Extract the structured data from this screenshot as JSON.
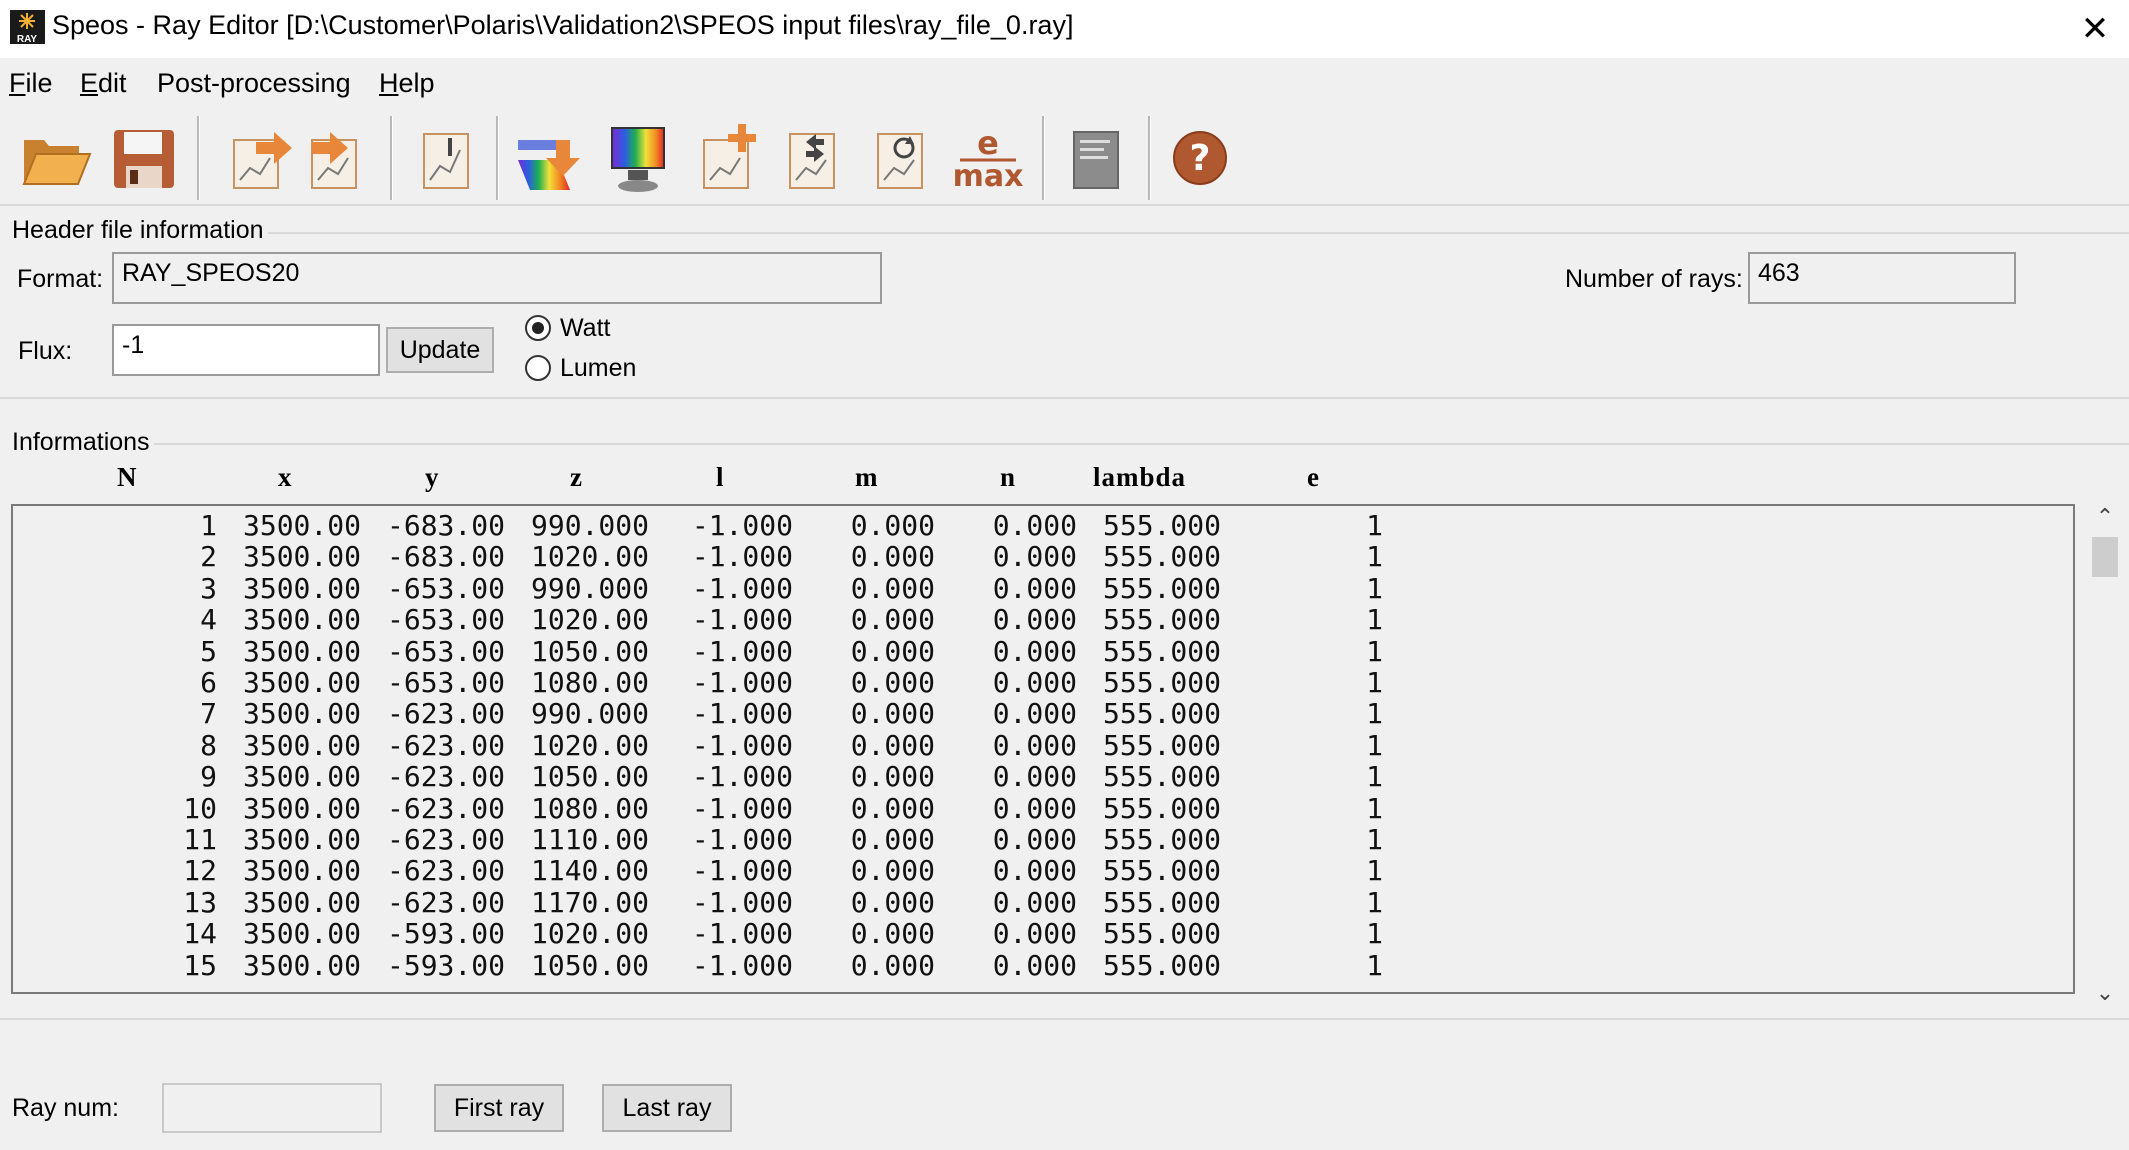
{
  "window": {
    "icon_label": "RAY",
    "title": "Speos - Ray Editor [D:\\Customer\\Polaris\\Validation2\\SPEOS input files\\ray_file_0.ray]",
    "close_glyph": "✕"
  },
  "menu": [
    {
      "accel": "F",
      "rest": "ile"
    },
    {
      "accel": "E",
      "rest": "dit"
    },
    {
      "accel": "",
      "rest": "Post-processing"
    },
    {
      "accel": "H",
      "rest": "elp"
    }
  ],
  "toolbar": {
    "icons": [
      "open-folder-icon",
      "save-disk-icon",
      "export-chart-icon",
      "import-chart-icon",
      "chart-settings-icon",
      "spectrum-download-icon",
      "spectrum-monitor-icon",
      "add-chart-icon",
      "chart-swap-icon",
      "chart-refresh-icon",
      "e-max-icon",
      "notepad-icon",
      "help-icon"
    ],
    "emax_top": "e",
    "emax_bottom": "max",
    "help_glyph": "?"
  },
  "header": {
    "group_label": "Header file information",
    "format_label": "Format:",
    "format_value": "RAY_SPEOS20",
    "rays_label": "Number of rays:",
    "rays_value": "463",
    "flux_label": "Flux:",
    "flux_value": "-1",
    "update_label": "Update",
    "unit_options": [
      "Watt",
      "Lumen"
    ],
    "unit_selected": "Watt"
  },
  "informations": {
    "group_label": "Informations",
    "columns": [
      "N",
      "x",
      "y",
      "z",
      "l",
      "m",
      "n",
      "lambda",
      "e"
    ],
    "rows": [
      [
        "1",
        "3500.00",
        "-683.00",
        "990.000",
        "-1.000",
        "0.000",
        "0.000",
        "555.000",
        "1"
      ],
      [
        "2",
        "3500.00",
        "-683.00",
        "1020.00",
        "-1.000",
        "0.000",
        "0.000",
        "555.000",
        "1"
      ],
      [
        "3",
        "3500.00",
        "-653.00",
        "990.000",
        "-1.000",
        "0.000",
        "0.000",
        "555.000",
        "1"
      ],
      [
        "4",
        "3500.00",
        "-653.00",
        "1020.00",
        "-1.000",
        "0.000",
        "0.000",
        "555.000",
        "1"
      ],
      [
        "5",
        "3500.00",
        "-653.00",
        "1050.00",
        "-1.000",
        "0.000",
        "0.000",
        "555.000",
        "1"
      ],
      [
        "6",
        "3500.00",
        "-653.00",
        "1080.00",
        "-1.000",
        "0.000",
        "0.000",
        "555.000",
        "1"
      ],
      [
        "7",
        "3500.00",
        "-623.00",
        "990.000",
        "-1.000",
        "0.000",
        "0.000",
        "555.000",
        "1"
      ],
      [
        "8",
        "3500.00",
        "-623.00",
        "1020.00",
        "-1.000",
        "0.000",
        "0.000",
        "555.000",
        "1"
      ],
      [
        "9",
        "3500.00",
        "-623.00",
        "1050.00",
        "-1.000",
        "0.000",
        "0.000",
        "555.000",
        "1"
      ],
      [
        "10",
        "3500.00",
        "-623.00",
        "1080.00",
        "-1.000",
        "0.000",
        "0.000",
        "555.000",
        "1"
      ],
      [
        "11",
        "3500.00",
        "-623.00",
        "1110.00",
        "-1.000",
        "0.000",
        "0.000",
        "555.000",
        "1"
      ],
      [
        "12",
        "3500.00",
        "-623.00",
        "1140.00",
        "-1.000",
        "0.000",
        "0.000",
        "555.000",
        "1"
      ],
      [
        "13",
        "3500.00",
        "-623.00",
        "1170.00",
        "-1.000",
        "0.000",
        "0.000",
        "555.000",
        "1"
      ],
      [
        "14",
        "3500.00",
        "-593.00",
        "1020.00",
        "-1.000",
        "0.000",
        "0.000",
        "555.000",
        "1"
      ],
      [
        "15",
        "3500.00",
        "-593.00",
        "1050.00",
        "-1.000",
        "0.000",
        "0.000",
        "555.000",
        "1"
      ]
    ]
  },
  "scroll": {
    "up": "⌃",
    "down": "⌄"
  },
  "footer": {
    "ray_num_label": "Ray num:",
    "ray_num_value": "",
    "first_label": "First ray",
    "last_label": "Last ray"
  }
}
